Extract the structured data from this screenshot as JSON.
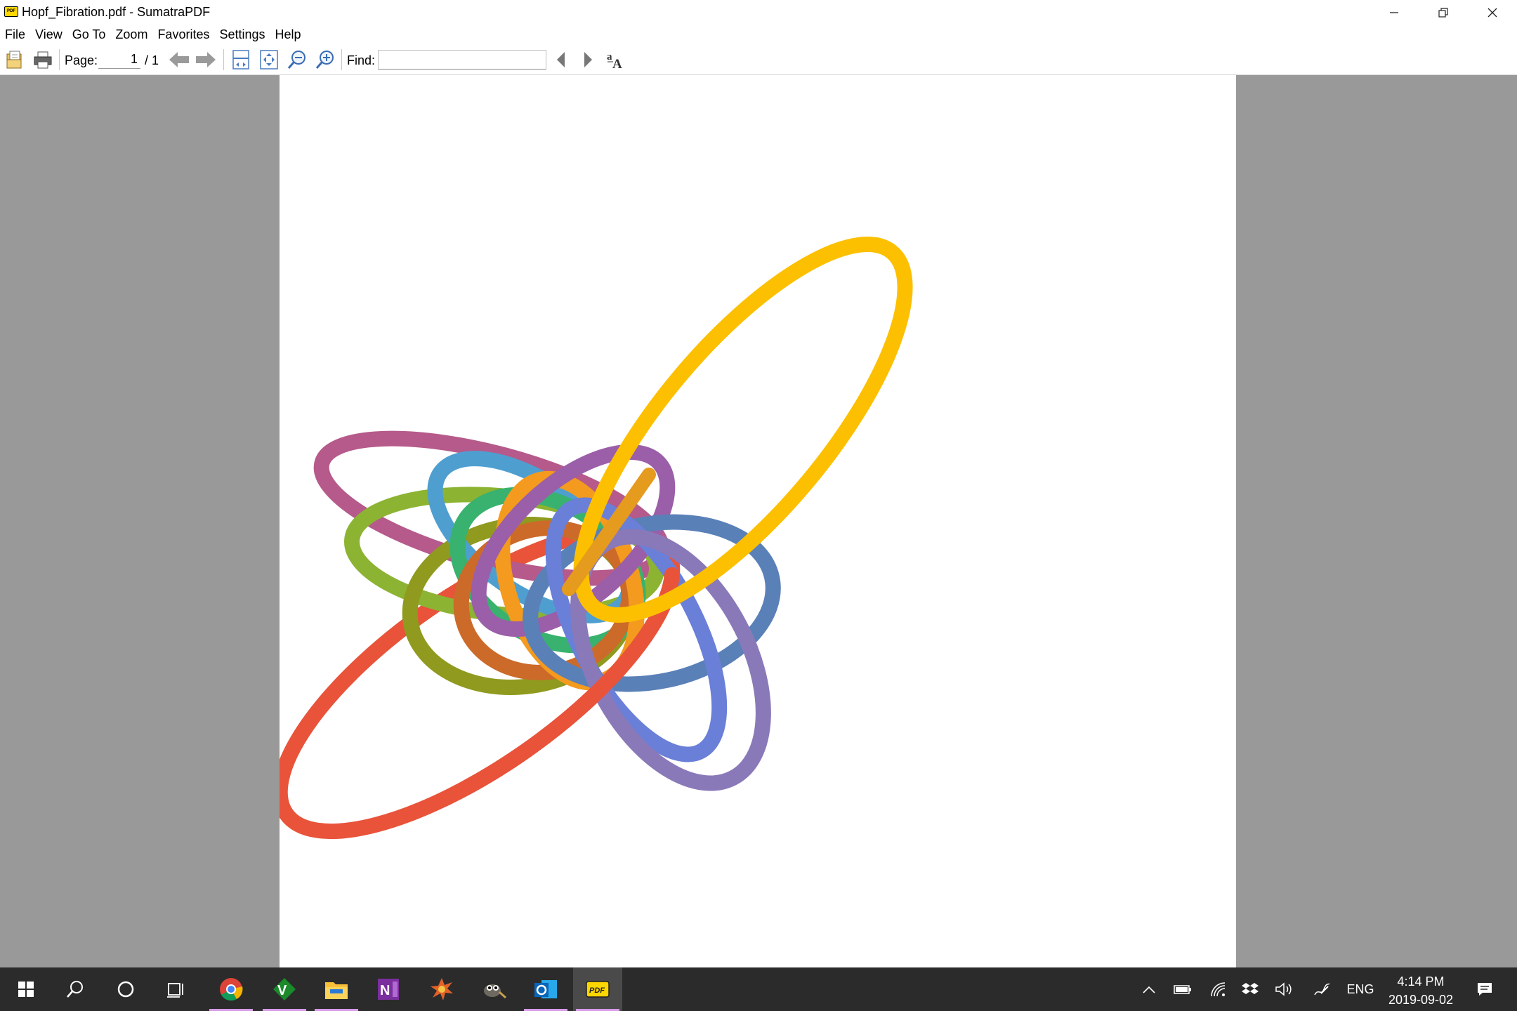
{
  "window": {
    "title": "Hopf_Fibration.pdf - SumatraPDF",
    "app_icon_text": "PDF"
  },
  "menu": [
    "File",
    "View",
    "Go To",
    "Zoom",
    "Favorites",
    "Settings",
    "Help"
  ],
  "toolbar": {
    "page_label": "Page:",
    "page_current": "1",
    "page_total": "/ 1",
    "find_label": "Find:",
    "find_value": ""
  },
  "document": {
    "ring_colors": {
      "red": "#e8533a",
      "yellow": "#fcc000",
      "magenta": "#b55a8a",
      "olive": "#8f9a1e",
      "light_green": "#8cb332",
      "sky_blue": "#4e9fd0",
      "green": "#38b26e",
      "orange": "#f39a1f",
      "rust": "#cc6a2a",
      "purple": "#9b5ea8",
      "steel_blue": "#5a80b8",
      "blue": "#6a7fd8",
      "lavender": "#8a79b8",
      "amber": "#e59b1e"
    }
  },
  "taskbar": {
    "apps": [
      "windows-start",
      "search",
      "cortana",
      "task-view",
      "chrome",
      "gvim",
      "file-explorer",
      "onenote",
      "burst-app",
      "gimp",
      "outlook",
      "sumatrapdf"
    ],
    "language": "ENG",
    "time": "4:14 PM",
    "date": "2019-09-02"
  }
}
